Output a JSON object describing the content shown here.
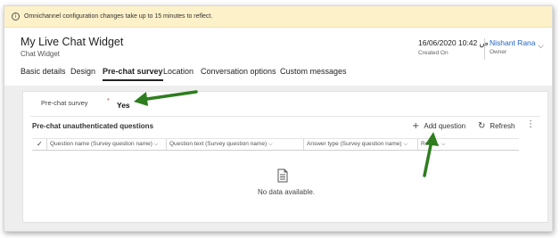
{
  "notification": {
    "text": "Omnichannel configuration changes take up to 15 minutes to reflect."
  },
  "header": {
    "title": "My Live Chat Widget",
    "subtitle": "Chat Widget",
    "created_on_value": "16/06/2020 10:42 ص",
    "created_on_label": "Created On",
    "owner_value": "Nishant Rana",
    "owner_label": "Owner"
  },
  "tabs": [
    {
      "label": "Basic details",
      "active": false
    },
    {
      "label": "Design",
      "active": false
    },
    {
      "label": "Pre-chat survey",
      "active": true
    },
    {
      "label": "Location",
      "active": false
    },
    {
      "label": "Conversation options",
      "active": false
    },
    {
      "label": "Custom messages",
      "active": false
    }
  ],
  "form": {
    "field_label": "Pre-chat survey",
    "required_marker": "*",
    "field_value": "Yes"
  },
  "subgrid": {
    "title": "Pre-chat unauthenticated questions",
    "add_label": "Add question",
    "refresh_label": "Refresh",
    "columns": [
      "Question name (Survey question name)",
      "Question text (Survey question name)",
      "Answer type (Survey question name)",
      "Requ..."
    ],
    "empty_message": "No data available."
  },
  "annotation": {
    "arrow_color": "#2e7d1f"
  }
}
